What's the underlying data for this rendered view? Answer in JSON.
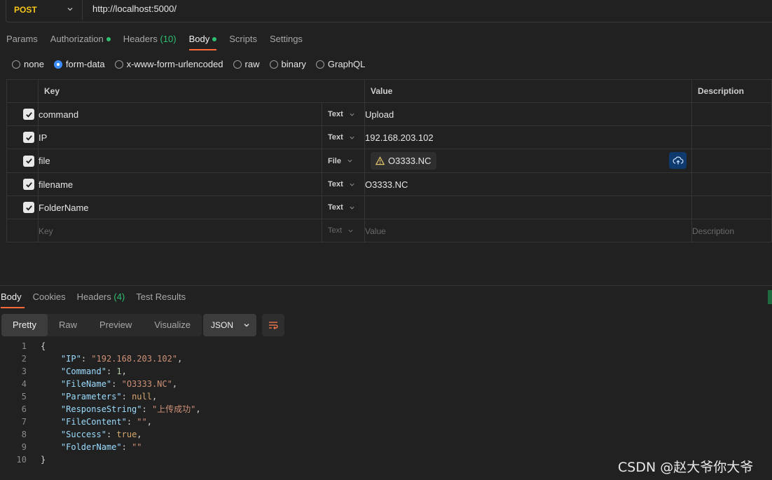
{
  "request": {
    "method": "POST",
    "url": "http://localhost:5000/"
  },
  "request_tabs": [
    {
      "label": "Params"
    },
    {
      "label": "Authorization",
      "dot": true
    },
    {
      "label": "Headers",
      "count": "(10)"
    },
    {
      "label": "Body",
      "dot": true,
      "active": true
    },
    {
      "label": "Scripts"
    },
    {
      "label": "Settings"
    }
  ],
  "body_types": [
    {
      "label": "none"
    },
    {
      "label": "form-data",
      "selected": true
    },
    {
      "label": "x-www-form-urlencoded"
    },
    {
      "label": "raw"
    },
    {
      "label": "binary"
    },
    {
      "label": "GraphQL"
    }
  ],
  "table": {
    "headers": {
      "key": "Key",
      "value": "Value",
      "description": "Description"
    },
    "rows": [
      {
        "key": "command",
        "type": "Text",
        "value": "Upload"
      },
      {
        "key": "IP",
        "type": "Text",
        "value": "192.168.203.102"
      },
      {
        "key": "file",
        "type": "File",
        "value": "O3333.NC"
      },
      {
        "key": "filename",
        "type": "Text",
        "value": "O3333.NC"
      },
      {
        "key": "FolderName",
        "type": "Text",
        "value": ""
      }
    ],
    "placeholder_row": {
      "key": "Key",
      "type": "Text",
      "value": "Value",
      "description": "Description"
    }
  },
  "response_tabs": [
    {
      "label": "Body",
      "active": true
    },
    {
      "label": "Cookies"
    },
    {
      "label": "Headers",
      "count": "(4)"
    },
    {
      "label": "Test Results"
    }
  ],
  "view_modes": [
    "Pretty",
    "Raw",
    "Preview",
    "Visualize"
  ],
  "format": "JSON",
  "response_lines": [
    "1",
    "2",
    "3",
    "4",
    "5",
    "6",
    "7",
    "8",
    "9",
    "10"
  ],
  "response_json": {
    "IP": "\"192.168.203.102\"",
    "Command": "1",
    "FileName": "\"O3333.NC\"",
    "Parameters": "null",
    "ResponseString": "\"上传成功\"",
    "FileContent": "\"\"",
    "Success": "true",
    "FolderName": "\"\""
  },
  "watermark": "CSDN @赵大爷你大爷",
  "colors": {
    "method": "#f5c518",
    "accent": "#ff6c37",
    "status_dot": "#2fbf71",
    "radio_selected": "#3d8dff"
  }
}
